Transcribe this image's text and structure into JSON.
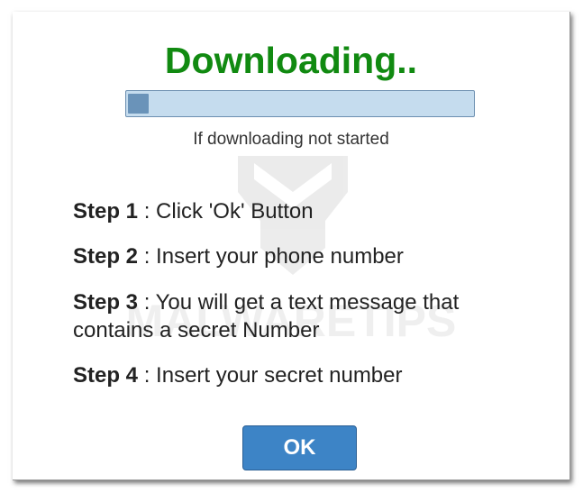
{
  "dialog": {
    "title": "Downloading..",
    "title_color": "#118a11",
    "progress": {
      "fraction": 0.06,
      "note": "If downloading not started",
      "track_color": "#c5dcee",
      "fill_color": "#6a93b9"
    },
    "steps": [
      {
        "label": "Step 1",
        "separator": " : ",
        "text": "Click 'Ok' Button"
      },
      {
        "label": "Step 2",
        "separator": " : ",
        "text": "Insert your phone number"
      },
      {
        "label": "Step 3",
        "separator": " : ",
        "text": "You will get a text message that contains a secret Number"
      },
      {
        "label": "Step 4",
        "separator": " : ",
        "text": "Insert your secret number"
      }
    ],
    "ok_button_label": "OK",
    "ok_button_color": "#3d84c6"
  },
  "watermark": {
    "text": "MALWARETIPS",
    "icon": "shield-logo-icon"
  }
}
